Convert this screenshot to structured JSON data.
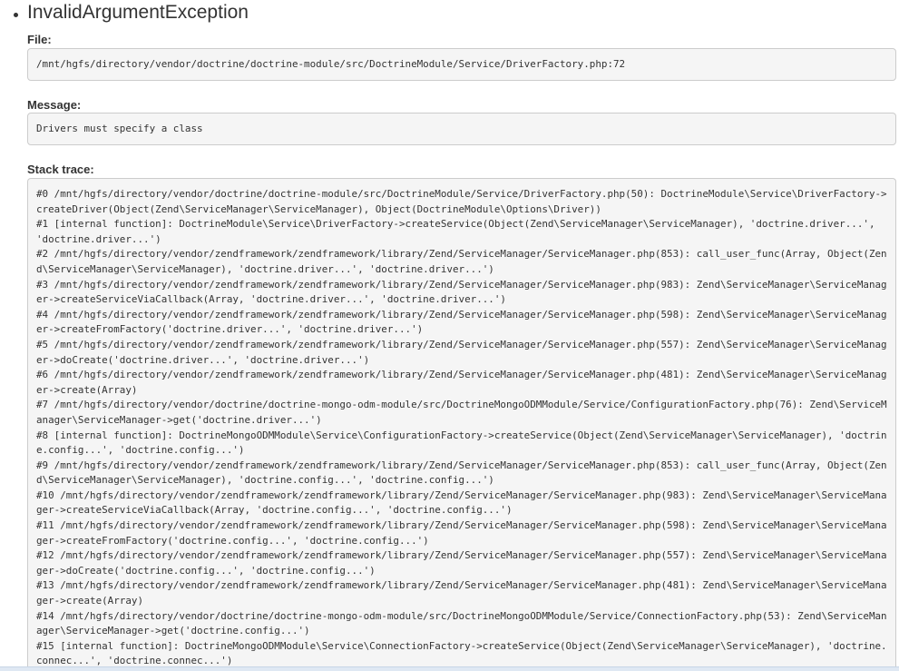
{
  "exception": {
    "title": "InvalidArgumentException",
    "file_label": "File:",
    "file_value": "/mnt/hgfs/directory/vendor/doctrine/doctrine-module/src/DoctrineModule/Service/DriverFactory.php:72",
    "message_label": "Message:",
    "message_value": "Drivers must specify a class",
    "trace_label": "Stack trace:",
    "trace_lines": [
      "#0 /mnt/hgfs/directory/vendor/doctrine/doctrine-module/src/DoctrineModule/Service/DriverFactory.php(50): DoctrineModule\\Service\\DriverFactory->createDriver(Object(Zend\\ServiceManager\\ServiceManager), Object(DoctrineModule\\Options\\Driver))",
      "#1 [internal function]: DoctrineModule\\Service\\DriverFactory->createService(Object(Zend\\ServiceManager\\ServiceManager), 'doctrine.driver...', 'doctrine.driver...')",
      "#2 /mnt/hgfs/directory/vendor/zendframework/zendframework/library/Zend/ServiceManager/ServiceManager.php(853): call_user_func(Array, Object(Zend\\ServiceManager\\ServiceManager), 'doctrine.driver...', 'doctrine.driver...')",
      "#3 /mnt/hgfs/directory/vendor/zendframework/zendframework/library/Zend/ServiceManager/ServiceManager.php(983): Zend\\ServiceManager\\ServiceManager->createServiceViaCallback(Array, 'doctrine.driver...', 'doctrine.driver...')",
      "#4 /mnt/hgfs/directory/vendor/zendframework/zendframework/library/Zend/ServiceManager/ServiceManager.php(598): Zend\\ServiceManager\\ServiceManager->createFromFactory('doctrine.driver...', 'doctrine.driver...')",
      "#5 /mnt/hgfs/directory/vendor/zendframework/zendframework/library/Zend/ServiceManager/ServiceManager.php(557): Zend\\ServiceManager\\ServiceManager->doCreate('doctrine.driver...', 'doctrine.driver...')",
      "#6 /mnt/hgfs/directory/vendor/zendframework/zendframework/library/Zend/ServiceManager/ServiceManager.php(481): Zend\\ServiceManager\\ServiceManager->create(Array)",
      "#7 /mnt/hgfs/directory/vendor/doctrine/doctrine-mongo-odm-module/src/DoctrineMongoODMModule/Service/ConfigurationFactory.php(76): Zend\\ServiceManager\\ServiceManager->get('doctrine.driver...')",
      "#8 [internal function]: DoctrineMongoODMModule\\Service\\ConfigurationFactory->createService(Object(Zend\\ServiceManager\\ServiceManager), 'doctrine.config...', 'doctrine.config...')",
      "#9 /mnt/hgfs/directory/vendor/zendframework/zendframework/library/Zend/ServiceManager/ServiceManager.php(853): call_user_func(Array, Object(Zend\\ServiceManager\\ServiceManager), 'doctrine.config...', 'doctrine.config...')",
      "#10 /mnt/hgfs/directory/vendor/zendframework/zendframework/library/Zend/ServiceManager/ServiceManager.php(983): Zend\\ServiceManager\\ServiceManager->createServiceViaCallback(Array, 'doctrine.config...', 'doctrine.config...')",
      "#11 /mnt/hgfs/directory/vendor/zendframework/zendframework/library/Zend/ServiceManager/ServiceManager.php(598): Zend\\ServiceManager\\ServiceManager->createFromFactory('doctrine.config...', 'doctrine.config...')",
      "#12 /mnt/hgfs/directory/vendor/zendframework/zendframework/library/Zend/ServiceManager/ServiceManager.php(557): Zend\\ServiceManager\\ServiceManager->doCreate('doctrine.config...', 'doctrine.config...')",
      "#13 /mnt/hgfs/directory/vendor/zendframework/zendframework/library/Zend/ServiceManager/ServiceManager.php(481): Zend\\ServiceManager\\ServiceManager->create(Array)",
      "#14 /mnt/hgfs/directory/vendor/doctrine/doctrine-mongo-odm-module/src/DoctrineMongoODMModule/Service/ConnectionFactory.php(53): Zend\\ServiceManager\\ServiceManager->get('doctrine.config...')",
      "#15 [internal function]: DoctrineMongoODMModule\\Service\\ConnectionFactory->createService(Object(Zend\\ServiceManager\\ServiceManager), 'doctrine.connec...', 'doctrine.connec...')"
    ]
  }
}
